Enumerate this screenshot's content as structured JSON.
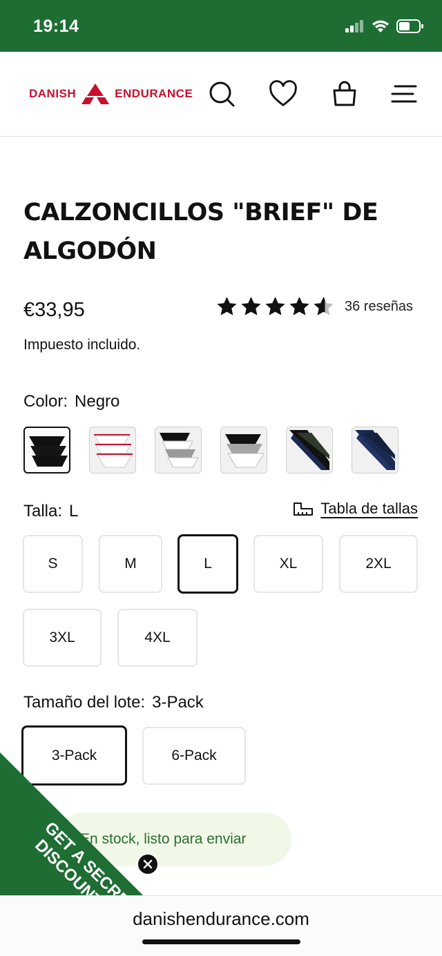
{
  "status_bar": {
    "time": "19:14",
    "bg_color": "#1e6e34"
  },
  "header": {
    "brand_left": "DANISH",
    "brand_right": "ENDURANCE",
    "brand_color": "#c8102e",
    "icons": [
      "search-icon",
      "heart-icon",
      "bag-icon",
      "menu-icon"
    ]
  },
  "product": {
    "title_line1": "CALZONCILLOS \"BRIEF\" DE",
    "title_line2": "ALGODÓN",
    "price": "€33,95",
    "rating": 4.5,
    "reviews": "36 reseñas",
    "tax_note": "Impuesto incluido."
  },
  "color": {
    "label": "Color:",
    "value": "Negro",
    "swatches": [
      "black",
      "white",
      "black-white-grey",
      "black-grey-white",
      "black-navy-green",
      "navy"
    ],
    "selected_index": 0
  },
  "size": {
    "label": "Talla:",
    "value": "L",
    "guide": "Tabla de tallas",
    "options": [
      "S",
      "M",
      "L",
      "XL",
      "2XL",
      "3XL",
      "4XL"
    ],
    "selected": "L"
  },
  "pack": {
    "label": "Tamaño del lote:",
    "value": "3-Pack",
    "options": [
      "3-Pack",
      "6-Pack"
    ],
    "selected": "3-Pack"
  },
  "stock": {
    "text": "En stock, listo para enviar"
  },
  "promo": {
    "line1": "GET A SECRET",
    "line2": "DISCOUNT",
    "color": "#1e6e34"
  },
  "browser": {
    "url": "danishendurance.com"
  }
}
